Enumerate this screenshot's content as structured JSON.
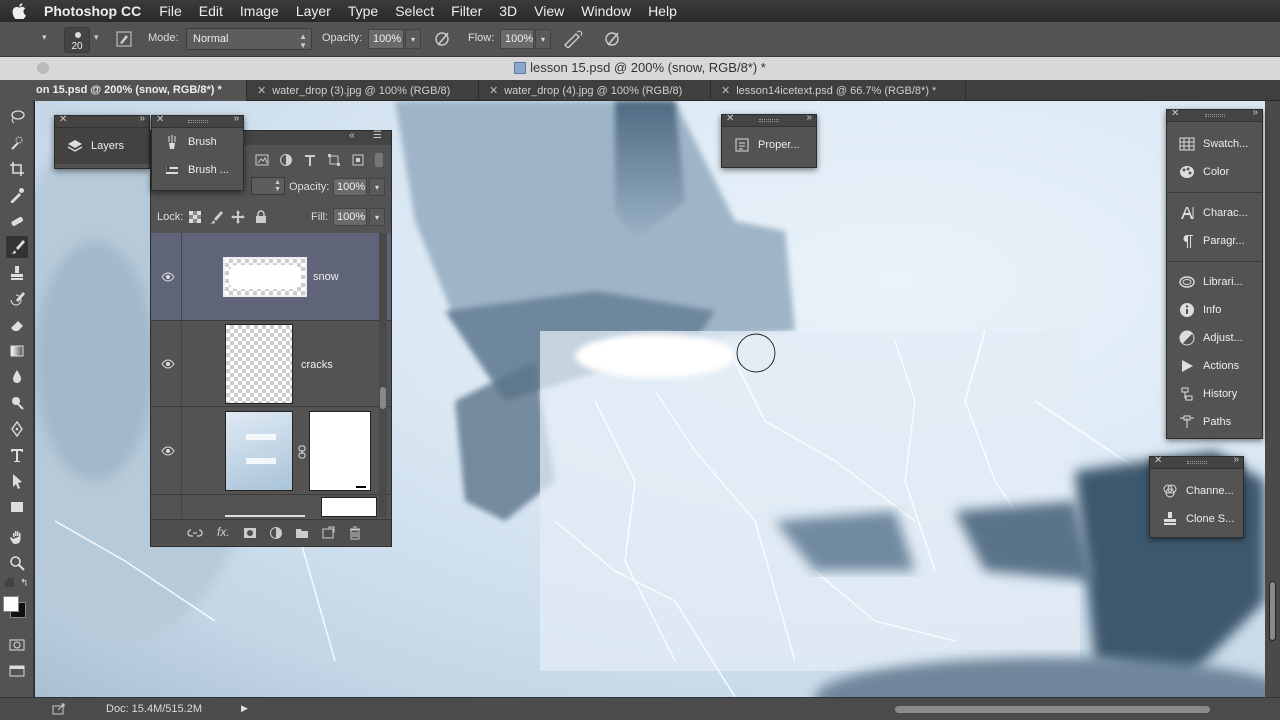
{
  "menubar": {
    "app": "Photoshop CC",
    "items": [
      "File",
      "Edit",
      "Image",
      "Layer",
      "Type",
      "Select",
      "Filter",
      "3D",
      "View",
      "Window",
      "Help"
    ]
  },
  "options": {
    "brush_size": "20",
    "mode_label": "Mode:",
    "mode_value": "Normal",
    "opacity_label": "Opacity:",
    "opacity_value": "100%",
    "flow_label": "Flow:",
    "flow_value": "100%"
  },
  "document": {
    "title": "lesson 15.psd @ 200% (snow, RGB/8*) *"
  },
  "tabs": [
    {
      "label": "on 15.psd @ 200% (snow, RGB/8*) *",
      "active": true
    },
    {
      "label": "water_drop (3).jpg @ 100% (RGB/8)",
      "active": false
    },
    {
      "label": "water_drop (4).jpg @ 100% (RGB/8)",
      "active": false
    },
    {
      "label": "lesson14icetext.psd @ 66.7% (RGB/8*) *",
      "active": false
    }
  ],
  "panels": {
    "layers_tab": "Layers",
    "brush": "Brush",
    "brush_presets": "Brush ...",
    "properties": "Proper...",
    "right": [
      "Swatch...",
      "Color",
      "Charac...",
      "Paragr...",
      "Librari...",
      "Info",
      "Adjust...",
      "Actions",
      "History",
      "Paths"
    ],
    "channels": "Channe...",
    "clone_source": "Clone S..."
  },
  "layers": {
    "opacity_label": "Opacity:",
    "opacity_value": "100%",
    "lock_label": "Lock:",
    "fill_label": "Fill:",
    "fill_value": "100%",
    "rows": [
      {
        "name": "snow",
        "selected": true
      },
      {
        "name": "cracks",
        "selected": false
      },
      {
        "name": "",
        "selected": false
      }
    ]
  },
  "status": {
    "doc": "Doc: 15.4M/515.2M"
  }
}
